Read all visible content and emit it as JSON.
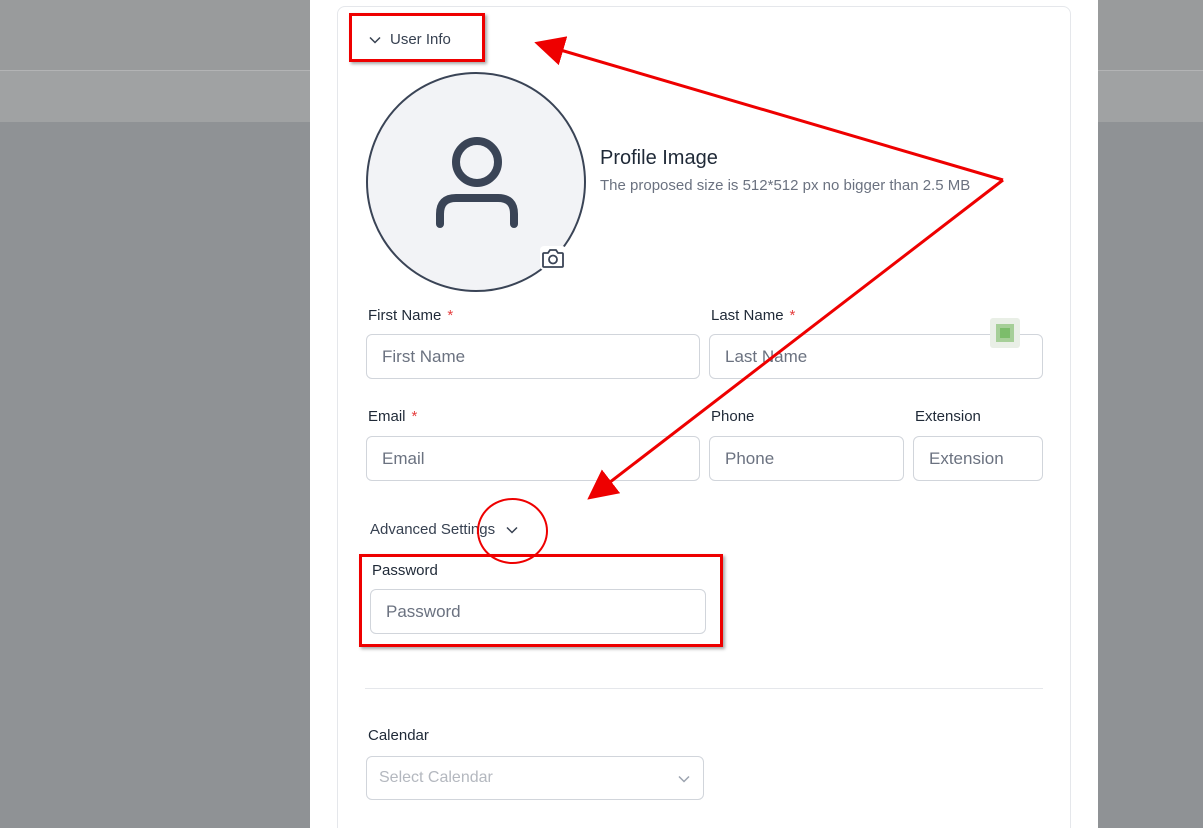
{
  "user_info": {
    "toggle_label": "User Info"
  },
  "profile": {
    "title": "Profile Image",
    "subtitle": "The proposed size is 512*512 px no bigger than 2.5 MB"
  },
  "fields": {
    "first_name": {
      "label": "First Name",
      "required_mark": "*",
      "placeholder": "First Name",
      "value": ""
    },
    "last_name": {
      "label": "Last Name",
      "required_mark": "*",
      "placeholder": "Last Name",
      "value": ""
    },
    "email": {
      "label": "Email",
      "required_mark": "*",
      "placeholder": "Email",
      "value": ""
    },
    "phone": {
      "label": "Phone",
      "placeholder": "Phone",
      "value": ""
    },
    "extension": {
      "label": "Extension",
      "placeholder": "Extension",
      "value": ""
    }
  },
  "advanced": {
    "toggle_label": "Advanced Settings",
    "password": {
      "label": "Password",
      "placeholder": "Password",
      "value": ""
    }
  },
  "calendar": {
    "label": "Calendar",
    "placeholder": "Select Calendar"
  },
  "icons": {
    "chevron": "chevron-down-icon",
    "avatar": "user-icon",
    "camera": "camera-icon"
  },
  "colors": {
    "annotation": "#ee0000",
    "required": "#e53e3e",
    "avatar_border": "#3a4456"
  }
}
